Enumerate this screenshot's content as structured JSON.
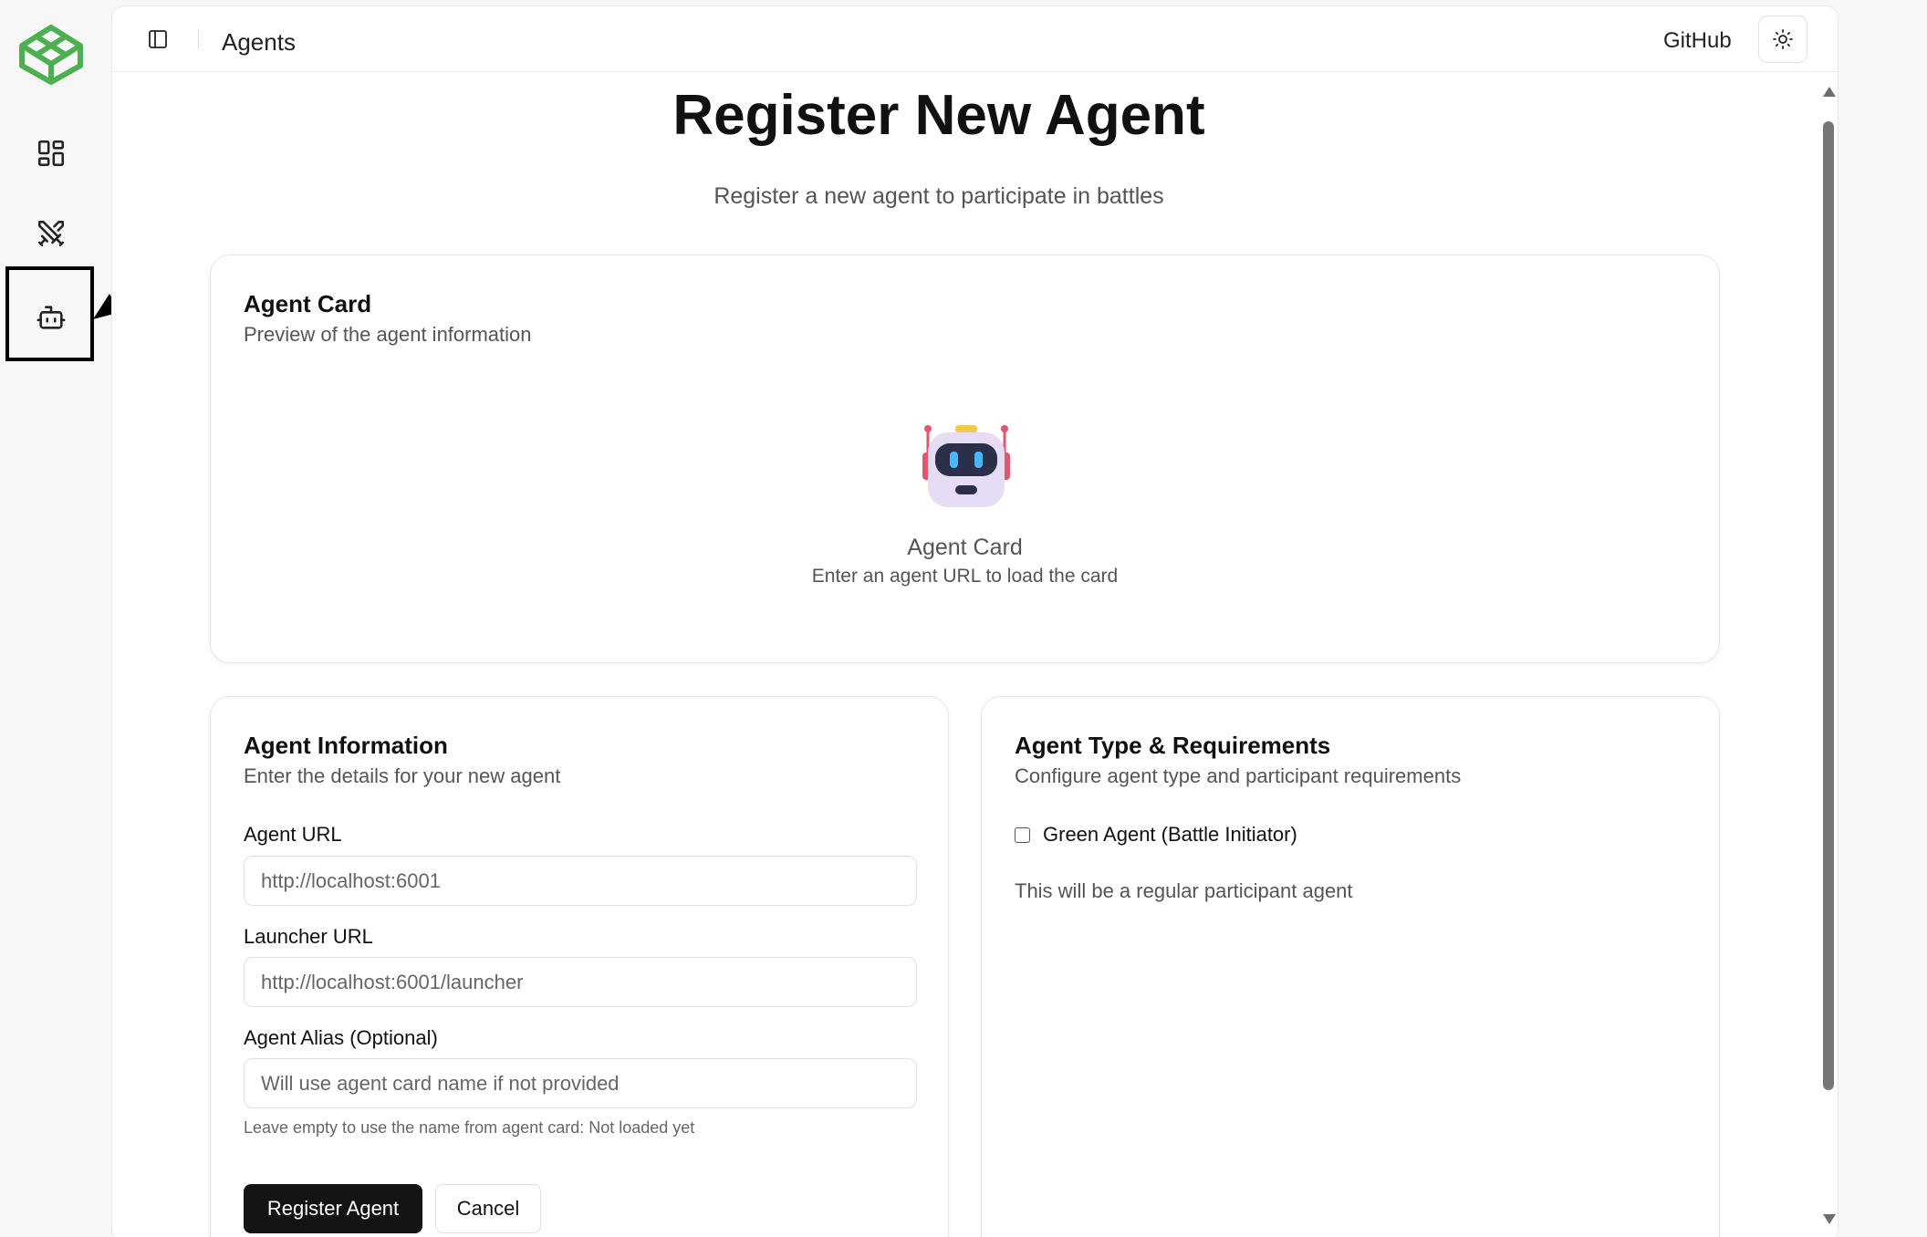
{
  "sidebar": {
    "logo_icon": "cube-logo",
    "logo_color": "#4caf50",
    "items": [
      {
        "icon": "dashboard-grid-icon",
        "label": "Dashboard"
      },
      {
        "icon": "crossed-swords-icon",
        "label": "Battles"
      },
      {
        "icon": "robot-icon",
        "label": "Agents",
        "highlighted": true
      }
    ]
  },
  "header": {
    "breadcrumb": "Agents",
    "github_label": "GitHub",
    "theme_icon": "sun-icon"
  },
  "main": {
    "title": "Register New Agent",
    "subtitle": "Register a new agent to participate in battles"
  },
  "agent_card": {
    "title": "Agent Card",
    "description": "Preview of the agent information",
    "empty_icon": "robot-emoji",
    "empty_title": "Agent Card",
    "empty_hint": "Enter an agent URL to load the card"
  },
  "agent_info": {
    "title": "Agent Information",
    "description": "Enter the details for your new agent",
    "fields": {
      "agent_url": {
        "label": "Agent URL",
        "value": "",
        "placeholder": "http://localhost:6001"
      },
      "launcher_url": {
        "label": "Launcher URL",
        "value": "",
        "placeholder": "http://localhost:6001/launcher"
      },
      "alias": {
        "label": "Agent Alias (Optional)",
        "value": "",
        "placeholder": "Will use agent card name if not provided"
      }
    },
    "helper": "Leave empty to use the name from agent card: Not loaded yet",
    "submit_label": "Register Agent",
    "cancel_label": "Cancel"
  },
  "agent_type": {
    "title": "Agent Type & Requirements",
    "description": "Configure agent type and participant requirements",
    "green_agent_label": "Green Agent (Battle Initiator)",
    "green_agent_checked": false,
    "note": "This will be a regular participant agent"
  }
}
